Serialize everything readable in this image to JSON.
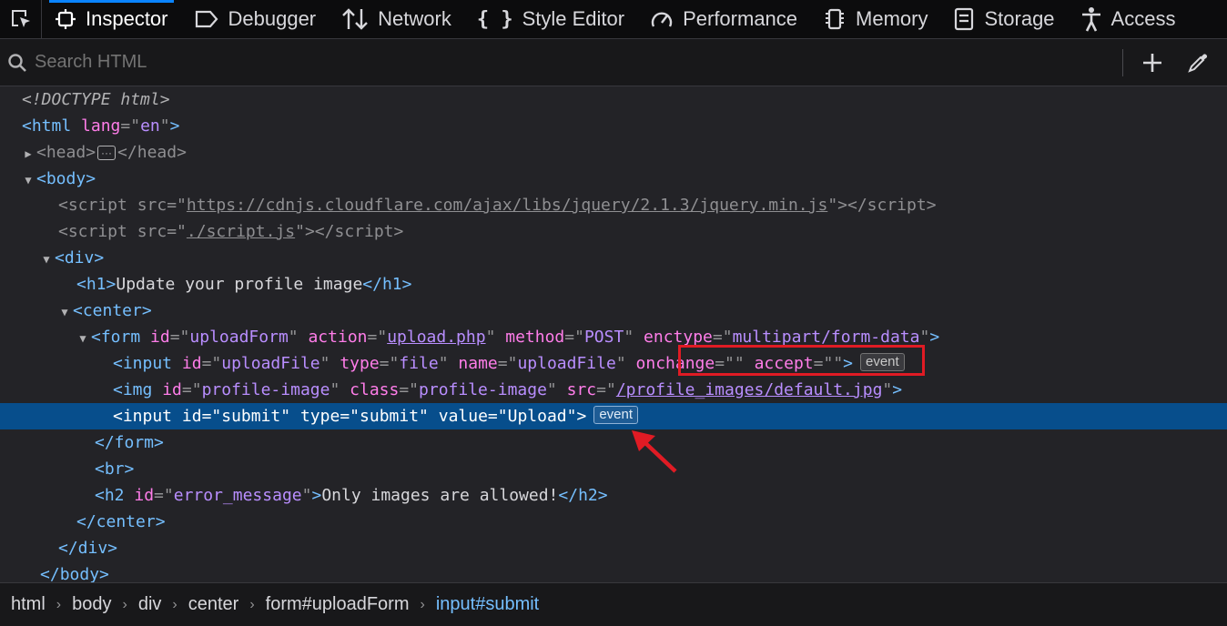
{
  "toolbar": {
    "picker_icon": "element-picker-icon",
    "tabs": [
      {
        "label": "Inspector",
        "icon": "inspector-icon",
        "active": true
      },
      {
        "label": "Debugger",
        "icon": "debugger-icon"
      },
      {
        "label": "Network",
        "icon": "network-icon"
      },
      {
        "label": "Style Editor",
        "icon": "style-editor-icon"
      },
      {
        "label": "Performance",
        "icon": "performance-icon"
      },
      {
        "label": "Memory",
        "icon": "memory-icon"
      },
      {
        "label": "Storage",
        "icon": "storage-icon"
      },
      {
        "label": "Access",
        "icon": "accessibility-icon"
      }
    ]
  },
  "search": {
    "placeholder": "Search HTML"
  },
  "markup": {
    "doctype": "<!DOCTYPE html>",
    "html_lang_value": "en",
    "head_tag": "head",
    "body_tag": "body",
    "script1_src": "https://cdnjs.cloudflare.com/ajax/libs/jquery/2.1.3/jquery.min.js",
    "script2_src": "./script.js",
    "h1_text": "Update your profile image",
    "form_id": "uploadForm",
    "form_action": "upload.php",
    "form_method": "POST",
    "form_enctype": "multipart/form-data",
    "input1_id": "uploadFile",
    "input1_type": "file",
    "input1_name": "uploadFile",
    "input1_onchange": "",
    "input1_accept": "",
    "img_id": "profile-image",
    "img_class": "profile-image",
    "img_src": "/profile_images/default.jpg",
    "input2_id": "submit",
    "input2_type": "submit",
    "input2_value": "Upload",
    "h2_id": "error_message",
    "h2_text": "Only images are allowed!",
    "event_label": "event"
  },
  "breadcrumbs": [
    "html",
    "body",
    "div",
    "center",
    "form#uploadForm",
    "input#submit"
  ]
}
